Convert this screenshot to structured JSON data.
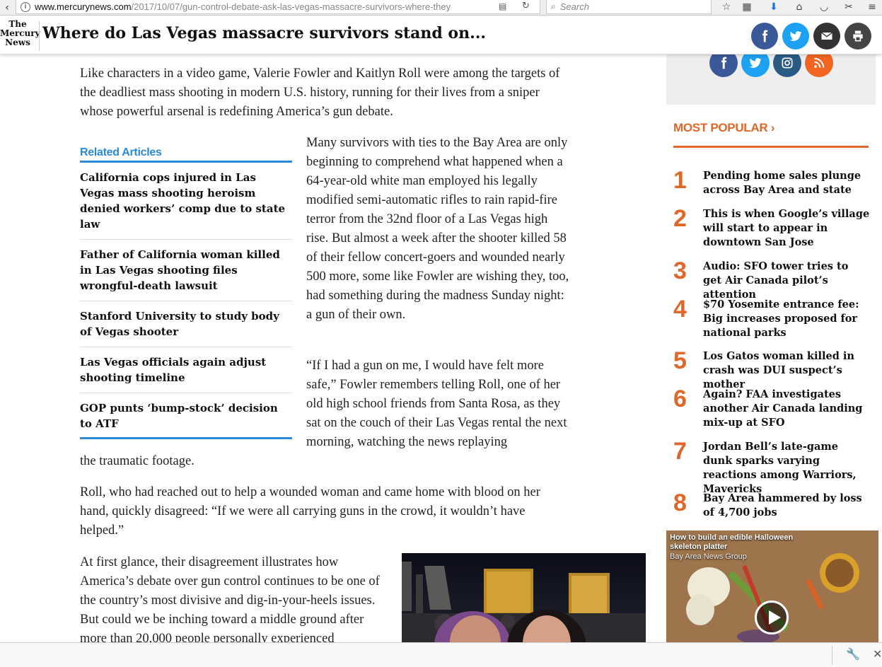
{
  "browser": {
    "url_host": "www.mercurynews.com",
    "url_path": "/2017/10/07/gun-control-debate-ask-las-vegas-massacre-survivors-where-they",
    "search_placeholder": "Search"
  },
  "header": {
    "logo_line1": "The",
    "logo_line2": "Mercury",
    "logo_line3": "News",
    "title": "Where do Las Vegas massacre survivors stand on..."
  },
  "article": {
    "lead": "Like characters in a video game, Valerie Fowler and Kaitlyn Roll were among the targets of the deadliest mass shooting in modern U.S. history, running for their lives from a sniper whose powerful arsenal is redefining America’s gun debate.",
    "para2": "Many survivors with ties to the Bay Area are only beginning to comprehend what happened when a 64-year-old white man employed his legally modified semi-automatic rifles to rain rapid-fire terror from the 32nd floor of a Las Vegas high rise. But almost a week after the shooter killed 58 of their fellow concert-goers and wounded nearly 500 more, some like Fowler are wishing they, too, had something during the madness Sunday night: a gun of their own.",
    "para3": "“If I had a gun on me, I would have felt more safe,” Fowler remembers telling Roll, one of her old high school friends from Santa Rosa, as they sat on the couch of their Las Vegas rental the next morning, watching the news replaying",
    "para3_end": "the traumatic footage.",
    "para4": "Roll, who had reached out to help a wounded woman and came home with blood on her hand, quickly disagreed: “If we were all carrying guns in the crowd, it wouldn’t have helped.”",
    "para5": "At first glance, their disagreement illustrates how America’s debate over gun control continues to be one of the country’s most divisive and dig-in-your-heels issues. But could we be inching toward a middle ground after more than 20,000 people personally experienced"
  },
  "related": {
    "heading": "Related Articles",
    "items": [
      "California cops injured in Las Vegas mass shooting heroism denied workers’ comp due to state law",
      "Father of California woman killed in Las Vegas shooting files wrongful-death lawsuit",
      "Stanford University to study body of Vegas shooter",
      "Las Vegas officials again adjust shooting timeline",
      "GOP punts ‘bump-stock’ decision to ATF"
    ]
  },
  "most_popular": {
    "heading": "MOST POPULAR ›",
    "items": [
      {
        "num": "1",
        "text": "Pending home sales plunge across Bay Area and state"
      },
      {
        "num": "2",
        "text": "This is when Google’s village will start to appear in downtown San Jose"
      },
      {
        "num": "3",
        "text": "Audio: SFO tower tries to get Air Canada pilot’s attention"
      },
      {
        "num": "4",
        "text": "$70 Yosemite entrance fee: Big increases proposed for national parks"
      },
      {
        "num": "5",
        "text": "Los Gatos woman killed in crash was DUI suspect’s mother"
      },
      {
        "num": "6",
        "text": "Again? FAA investigates another Air Canada landing mix-up at SFO"
      },
      {
        "num": "7",
        "text": "Jordan Bell’s late-game dunk sparks varying reactions among Warriors, Mavericks"
      },
      {
        "num": "8",
        "text": "Bay Area hammered by loss of 4,700 jobs"
      }
    ]
  },
  "video": {
    "title": "How to build an edible Halloween skeleton platter",
    "source": "Bay Area News Group"
  },
  "colors": {
    "facebook": "#3b5998",
    "twitter": "#1da1f2",
    "instagram": "#2a5b84",
    "rss": "#f26522",
    "mail": "#333333",
    "accent_blue": "#2b8ad8",
    "accent_orange": "#e0672a"
  }
}
